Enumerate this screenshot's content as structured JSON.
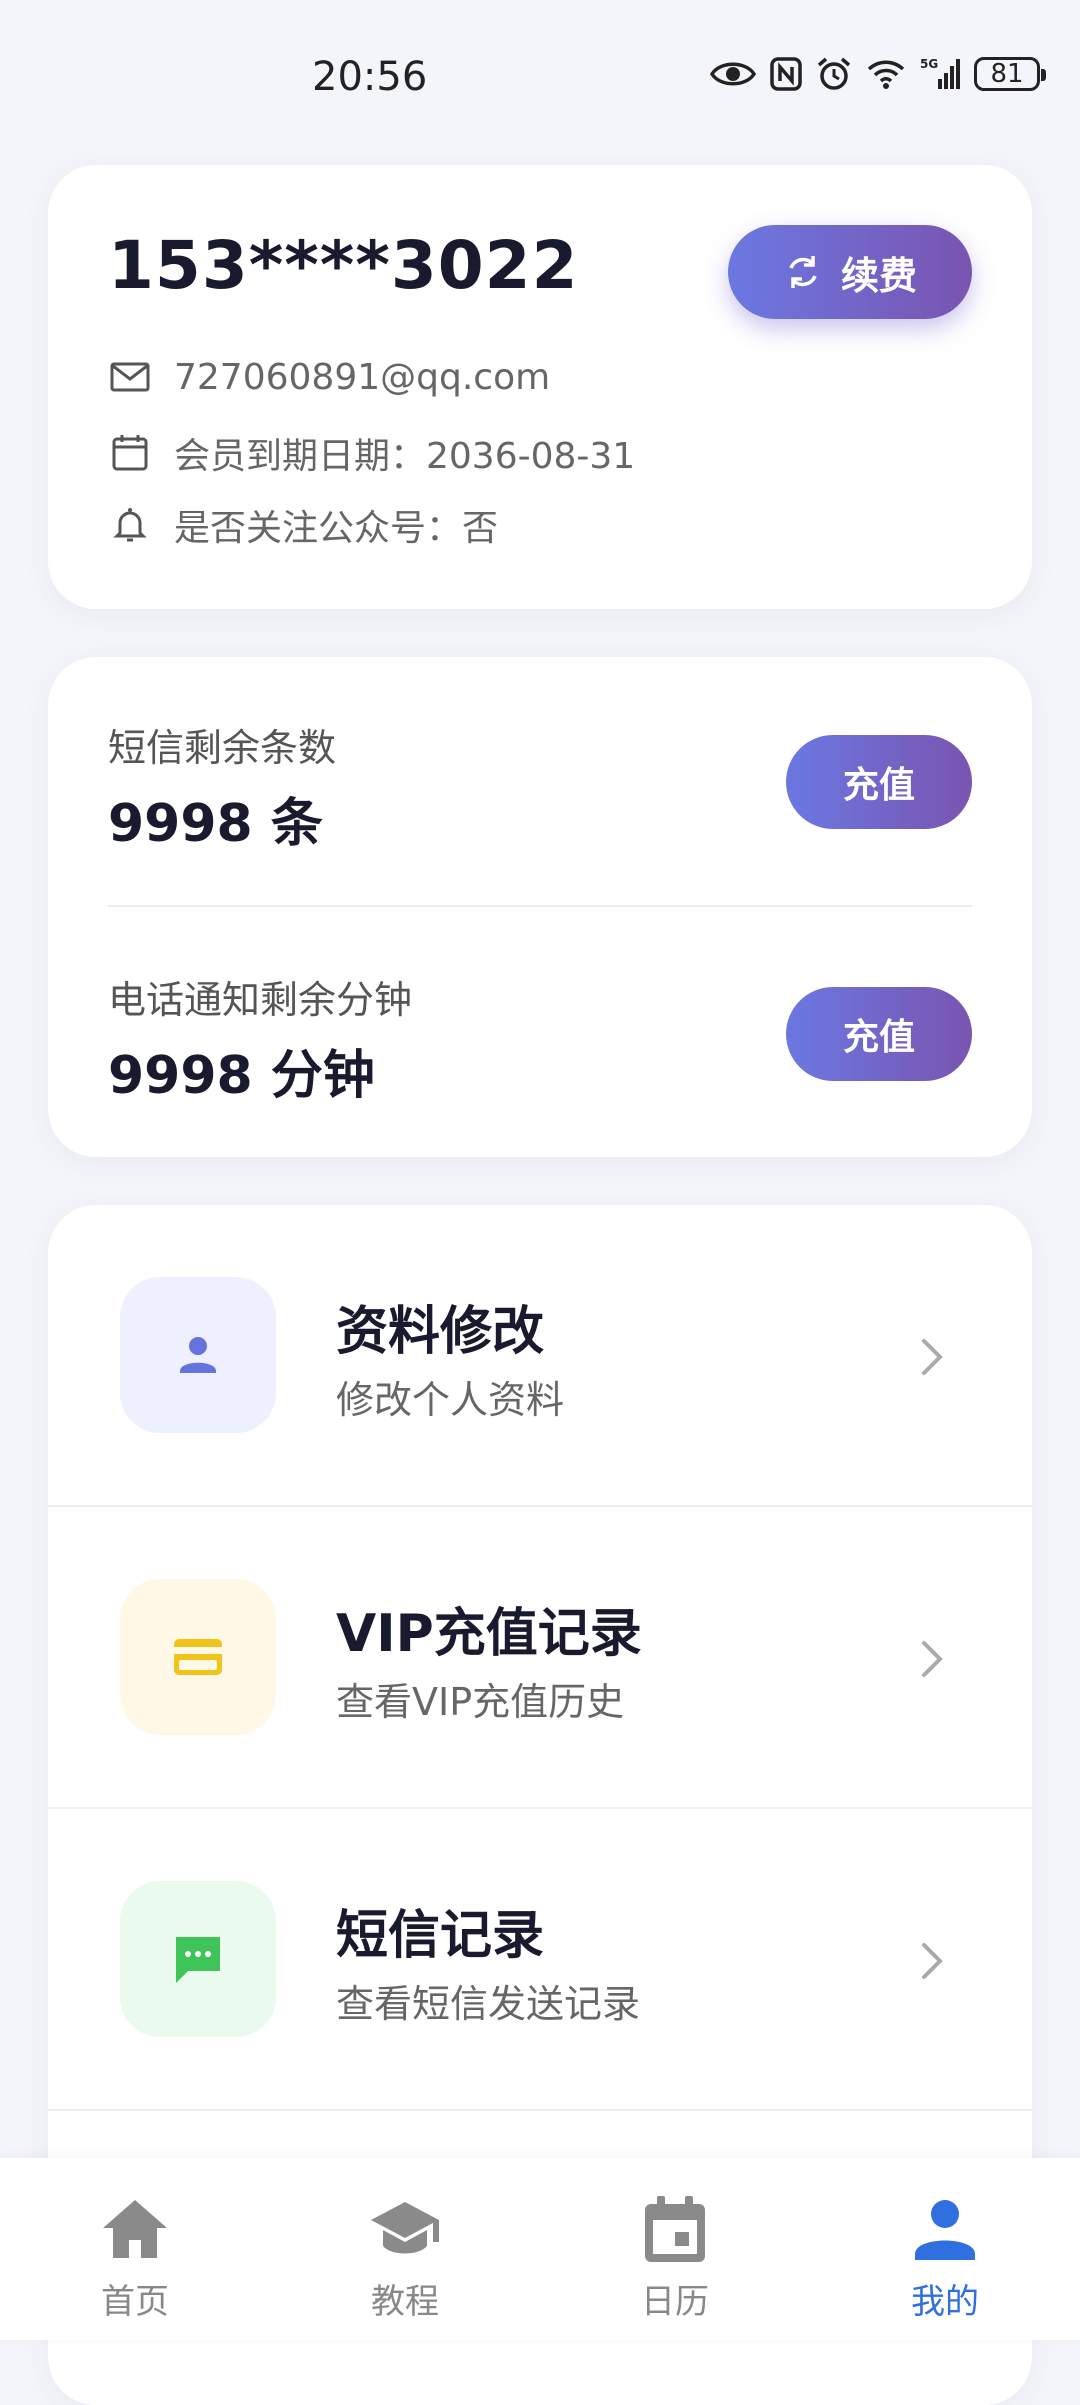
{
  "status_bar": {
    "time": "20:56",
    "battery": "81",
    "network": "5G"
  },
  "account": {
    "phone": "153****3022",
    "renew_label": "续费",
    "email": "727060891@qq.com",
    "expiry": "会员到期日期：2036-08-31",
    "follow": "是否关注公众号：否"
  },
  "quota": {
    "sms_label": "短信剩余条数",
    "sms_value": "9998 条",
    "sms_button": "充值",
    "call_label": "电话通知剩余分钟",
    "call_value": "9998 分钟",
    "call_button": "充值"
  },
  "menu": [
    {
      "title": "资料修改",
      "subtitle": "修改个人资料",
      "icon": "person-icon",
      "color": "#6673dc",
      "bg": "#eef0fd"
    },
    {
      "title": "VIP充值记录",
      "subtitle": "查看VIP充值历史",
      "icon": "card-icon",
      "color": "#f2c31a",
      "bg": "#fff8e6"
    },
    {
      "title": "短信记录",
      "subtitle": "查看短信发送记录",
      "icon": "message-icon",
      "color": "#3fc45a",
      "bg": "#eafaee"
    }
  ],
  "tabs": [
    {
      "label": "首页",
      "icon": "home-icon"
    },
    {
      "label": "教程",
      "icon": "school-icon"
    },
    {
      "label": "日历",
      "icon": "calendar-icon"
    },
    {
      "label": "我的",
      "icon": "person-icon",
      "active": true
    }
  ],
  "colors": {
    "accent": "#2f6fe0",
    "gradient_start": "#6b78e2",
    "gradient_end": "#7a54b0"
  }
}
